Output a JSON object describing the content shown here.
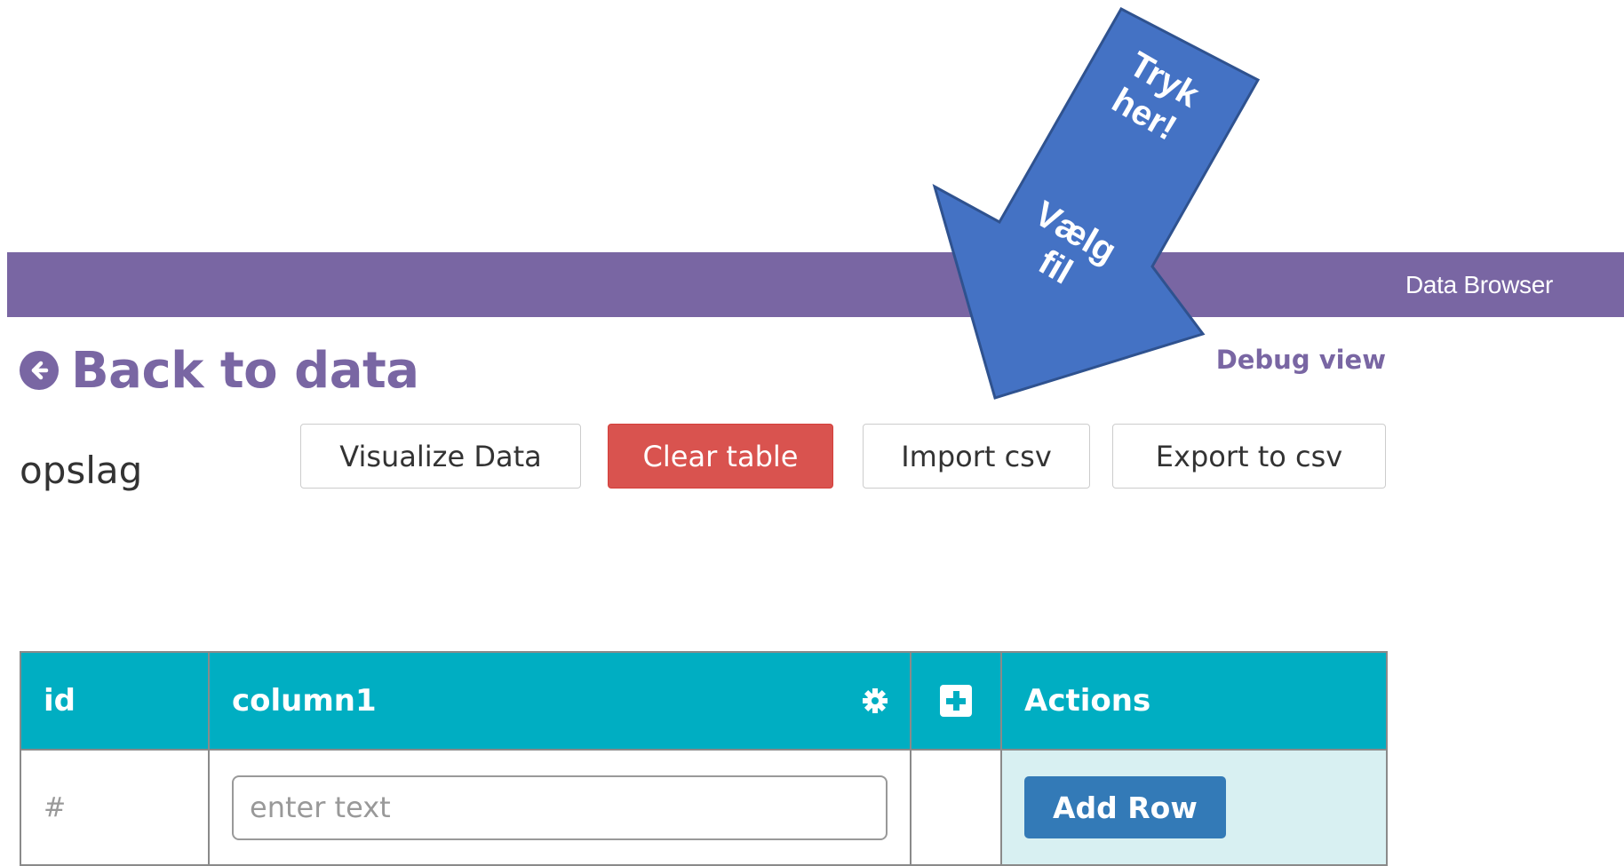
{
  "header": {
    "title": "Data Browser"
  },
  "nav": {
    "back_label": "Back to data",
    "debug_label": "Debug view"
  },
  "table_name": "opslag",
  "toolbar": {
    "visualize_label": "Visualize Data",
    "clear_label": "Clear table",
    "import_label": "Import csv",
    "export_label": "Export to csv"
  },
  "grid": {
    "columns": [
      "id",
      "column1",
      "Actions"
    ],
    "new_row": {
      "id_placeholder": "#",
      "input_placeholder": "enter text",
      "add_label": "Add Row"
    }
  },
  "callout": {
    "line1": "Tryk",
    "line2": "her!",
    "line3": "Vælg",
    "line4": "fil"
  },
  "colors": {
    "brand_purple": "#7966a3",
    "header_teal": "#00aec2",
    "danger_red": "#d9534f",
    "primary_blue": "#337ab7",
    "arrow_blue": "#4472c4"
  }
}
